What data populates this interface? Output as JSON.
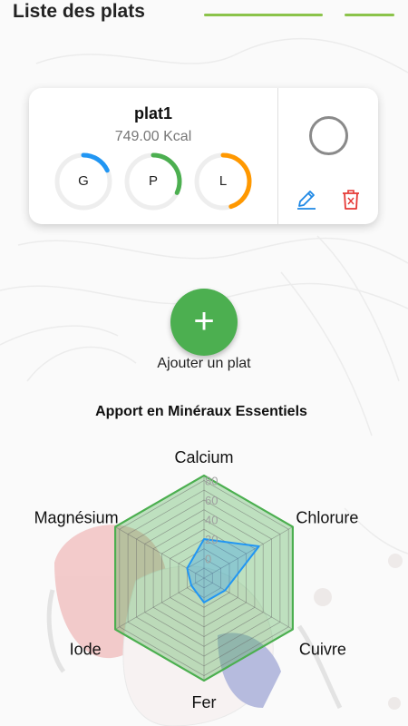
{
  "header": {
    "title": "Liste des plats"
  },
  "plats": [
    {
      "name": "plat1",
      "kcal": "749.00 Kcal",
      "macros": [
        {
          "label": "G",
          "fraction": 0.18,
          "color": "#2196f3"
        },
        {
          "label": "P",
          "fraction": 0.32,
          "color": "#4caf50"
        },
        {
          "label": "L",
          "fraction": 0.45,
          "color": "#ff9800"
        }
      ]
    }
  ],
  "actions": {
    "edit_icon": "pencil-icon",
    "delete_icon": "trash-icon",
    "edit_color": "#1e88e5",
    "delete_color": "#e53935"
  },
  "add": {
    "icon": "plus-icon",
    "label": "Ajouter un plat"
  },
  "chart_data": {
    "type": "radar",
    "title": "Apport en Minéraux Essentiels",
    "axes": [
      "Calcium",
      "Chlorure",
      "Cuivre",
      "Fer",
      "Iode",
      "Magnésium"
    ],
    "ticks": [
      "0",
      "20",
      "40",
      "60",
      "80"
    ],
    "range": [
      -20,
      85
    ],
    "series": [
      {
        "values": [
          85,
          85,
          85,
          85,
          85,
          85
        ],
        "color": "#4caf50"
      },
      {
        "values": [
          20,
          45,
          5,
          5,
          -5,
          0
        ],
        "color": "#2196f3"
      }
    ]
  },
  "colors": {
    "accent": "#4caf50",
    "header_line": "#8bc34a"
  }
}
